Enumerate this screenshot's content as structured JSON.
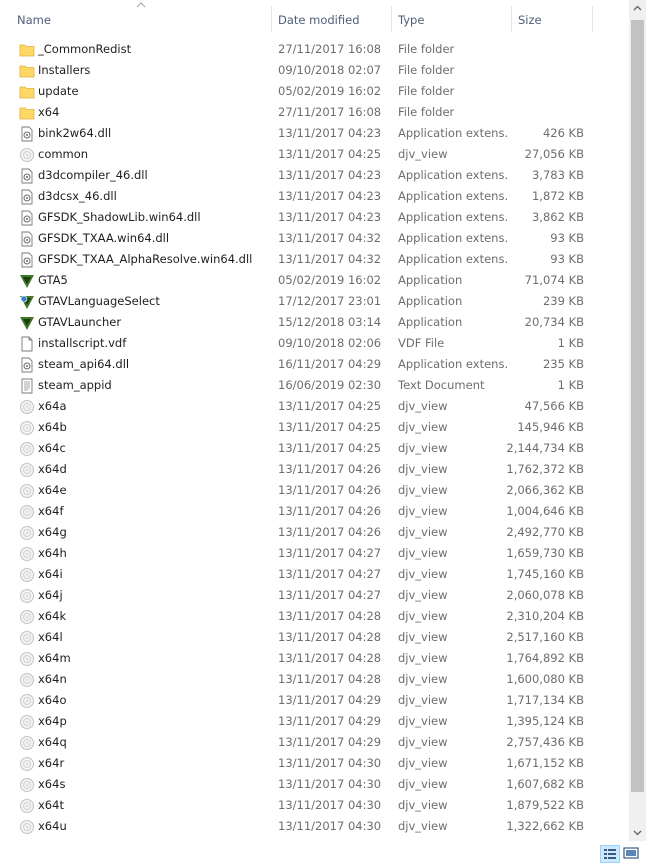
{
  "columns": {
    "name": "Name",
    "date": "Date modified",
    "type": "Type",
    "size": "Size"
  },
  "files": [
    {
      "name": "_CommonRedist",
      "date": "27/11/2017 16:08",
      "type": "File folder",
      "size": "",
      "icon": "folder-icon"
    },
    {
      "name": "Installers",
      "date": "09/10/2018 02:07",
      "type": "File folder",
      "size": "",
      "icon": "folder-icon"
    },
    {
      "name": "update",
      "date": "05/02/2019 16:02",
      "type": "File folder",
      "size": "",
      "icon": "folder-icon"
    },
    {
      "name": "x64",
      "date": "27/11/2017 16:08",
      "type": "File folder",
      "size": "",
      "icon": "folder-icon"
    },
    {
      "name": "bink2w64.dll",
      "date": "13/11/2017 04:23",
      "type": "Application extens...",
      "size": "426 KB",
      "icon": "dll-icon"
    },
    {
      "name": "common",
      "date": "13/11/2017 04:25",
      "type": "djv_view",
      "size": "27,056 KB",
      "icon": "djv-icon"
    },
    {
      "name": "d3dcompiler_46.dll",
      "date": "13/11/2017 04:23",
      "type": "Application extens...",
      "size": "3,783 KB",
      "icon": "dll-icon"
    },
    {
      "name": "d3dcsx_46.dll",
      "date": "13/11/2017 04:23",
      "type": "Application extens...",
      "size": "1,872 KB",
      "icon": "dll-icon"
    },
    {
      "name": "GFSDK_ShadowLib.win64.dll",
      "date": "13/11/2017 04:23",
      "type": "Application extens...",
      "size": "3,862 KB",
      "icon": "dll-icon"
    },
    {
      "name": "GFSDK_TXAA.win64.dll",
      "date": "13/11/2017 04:32",
      "type": "Application extens...",
      "size": "93 KB",
      "icon": "dll-icon"
    },
    {
      "name": "GFSDK_TXAA_AlphaResolve.win64.dll",
      "date": "13/11/2017 04:32",
      "type": "Application extens...",
      "size": "93 KB",
      "icon": "dll-icon"
    },
    {
      "name": "GTA5",
      "date": "05/02/2019 16:02",
      "type": "Application",
      "size": "71,074 KB",
      "icon": "gtav-icon"
    },
    {
      "name": "GTAVLanguageSelect",
      "date": "17/12/2017 23:01",
      "type": "Application",
      "size": "239 KB",
      "icon": "gtav-lang-icon"
    },
    {
      "name": "GTAVLauncher",
      "date": "15/12/2018 03:14",
      "type": "Application",
      "size": "20,734 KB",
      "icon": "gtav-icon"
    },
    {
      "name": "installscript.vdf",
      "date": "09/10/2018 02:06",
      "type": "VDF File",
      "size": "1 KB",
      "icon": "file-icon"
    },
    {
      "name": "steam_api64.dll",
      "date": "16/11/2017 04:29",
      "type": "Application extens...",
      "size": "235 KB",
      "icon": "dll-icon"
    },
    {
      "name": "steam_appid",
      "date": "16/06/2019 02:30",
      "type": "Text Document",
      "size": "1 KB",
      "icon": "text-icon"
    },
    {
      "name": "x64a",
      "date": "13/11/2017 04:25",
      "type": "djv_view",
      "size": "47,566 KB",
      "icon": "djv-icon"
    },
    {
      "name": "x64b",
      "date": "13/11/2017 04:25",
      "type": "djv_view",
      "size": "145,946 KB",
      "icon": "djv-icon"
    },
    {
      "name": "x64c",
      "date": "13/11/2017 04:25",
      "type": "djv_view",
      "size": "2,144,734 KB",
      "icon": "djv-icon"
    },
    {
      "name": "x64d",
      "date": "13/11/2017 04:26",
      "type": "djv_view",
      "size": "1,762,372 KB",
      "icon": "djv-icon"
    },
    {
      "name": "x64e",
      "date": "13/11/2017 04:26",
      "type": "djv_view",
      "size": "2,066,362 KB",
      "icon": "djv-icon"
    },
    {
      "name": "x64f",
      "date": "13/11/2017 04:26",
      "type": "djv_view",
      "size": "1,004,646 KB",
      "icon": "djv-icon"
    },
    {
      "name": "x64g",
      "date": "13/11/2017 04:26",
      "type": "djv_view",
      "size": "2,492,770 KB",
      "icon": "djv-icon"
    },
    {
      "name": "x64h",
      "date": "13/11/2017 04:27",
      "type": "djv_view",
      "size": "1,659,730 KB",
      "icon": "djv-icon"
    },
    {
      "name": "x64i",
      "date": "13/11/2017 04:27",
      "type": "djv_view",
      "size": "1,745,160 KB",
      "icon": "djv-icon"
    },
    {
      "name": "x64j",
      "date": "13/11/2017 04:27",
      "type": "djv_view",
      "size": "2,060,078 KB",
      "icon": "djv-icon"
    },
    {
      "name": "x64k",
      "date": "13/11/2017 04:28",
      "type": "djv_view",
      "size": "2,310,204 KB",
      "icon": "djv-icon"
    },
    {
      "name": "x64l",
      "date": "13/11/2017 04:28",
      "type": "djv_view",
      "size": "2,517,160 KB",
      "icon": "djv-icon"
    },
    {
      "name": "x64m",
      "date": "13/11/2017 04:28",
      "type": "djv_view",
      "size": "1,764,892 KB",
      "icon": "djv-icon"
    },
    {
      "name": "x64n",
      "date": "13/11/2017 04:28",
      "type": "djv_view",
      "size": "1,600,080 KB",
      "icon": "djv-icon"
    },
    {
      "name": "x64o",
      "date": "13/11/2017 04:29",
      "type": "djv_view",
      "size": "1,717,134 KB",
      "icon": "djv-icon"
    },
    {
      "name": "x64p",
      "date": "13/11/2017 04:29",
      "type": "djv_view",
      "size": "1,395,124 KB",
      "icon": "djv-icon"
    },
    {
      "name": "x64q",
      "date": "13/11/2017 04:29",
      "type": "djv_view",
      "size": "2,757,436 KB",
      "icon": "djv-icon"
    },
    {
      "name": "x64r",
      "date": "13/11/2017 04:30",
      "type": "djv_view",
      "size": "1,671,152 KB",
      "icon": "djv-icon"
    },
    {
      "name": "x64s",
      "date": "13/11/2017 04:30",
      "type": "djv_view",
      "size": "1,607,682 KB",
      "icon": "djv-icon"
    },
    {
      "name": "x64t",
      "date": "13/11/2017 04:30",
      "type": "djv_view",
      "size": "1,879,522 KB",
      "icon": "djv-icon"
    },
    {
      "name": "x64u",
      "date": "13/11/2017 04:30",
      "type": "djv_view",
      "size": "1,322,662 KB",
      "icon": "djv-icon"
    }
  ],
  "colors": {
    "header_text": "#4c607a",
    "folder": "#ffd766",
    "gtav": "#3f7a26",
    "selected_view": "#cce8ff"
  }
}
